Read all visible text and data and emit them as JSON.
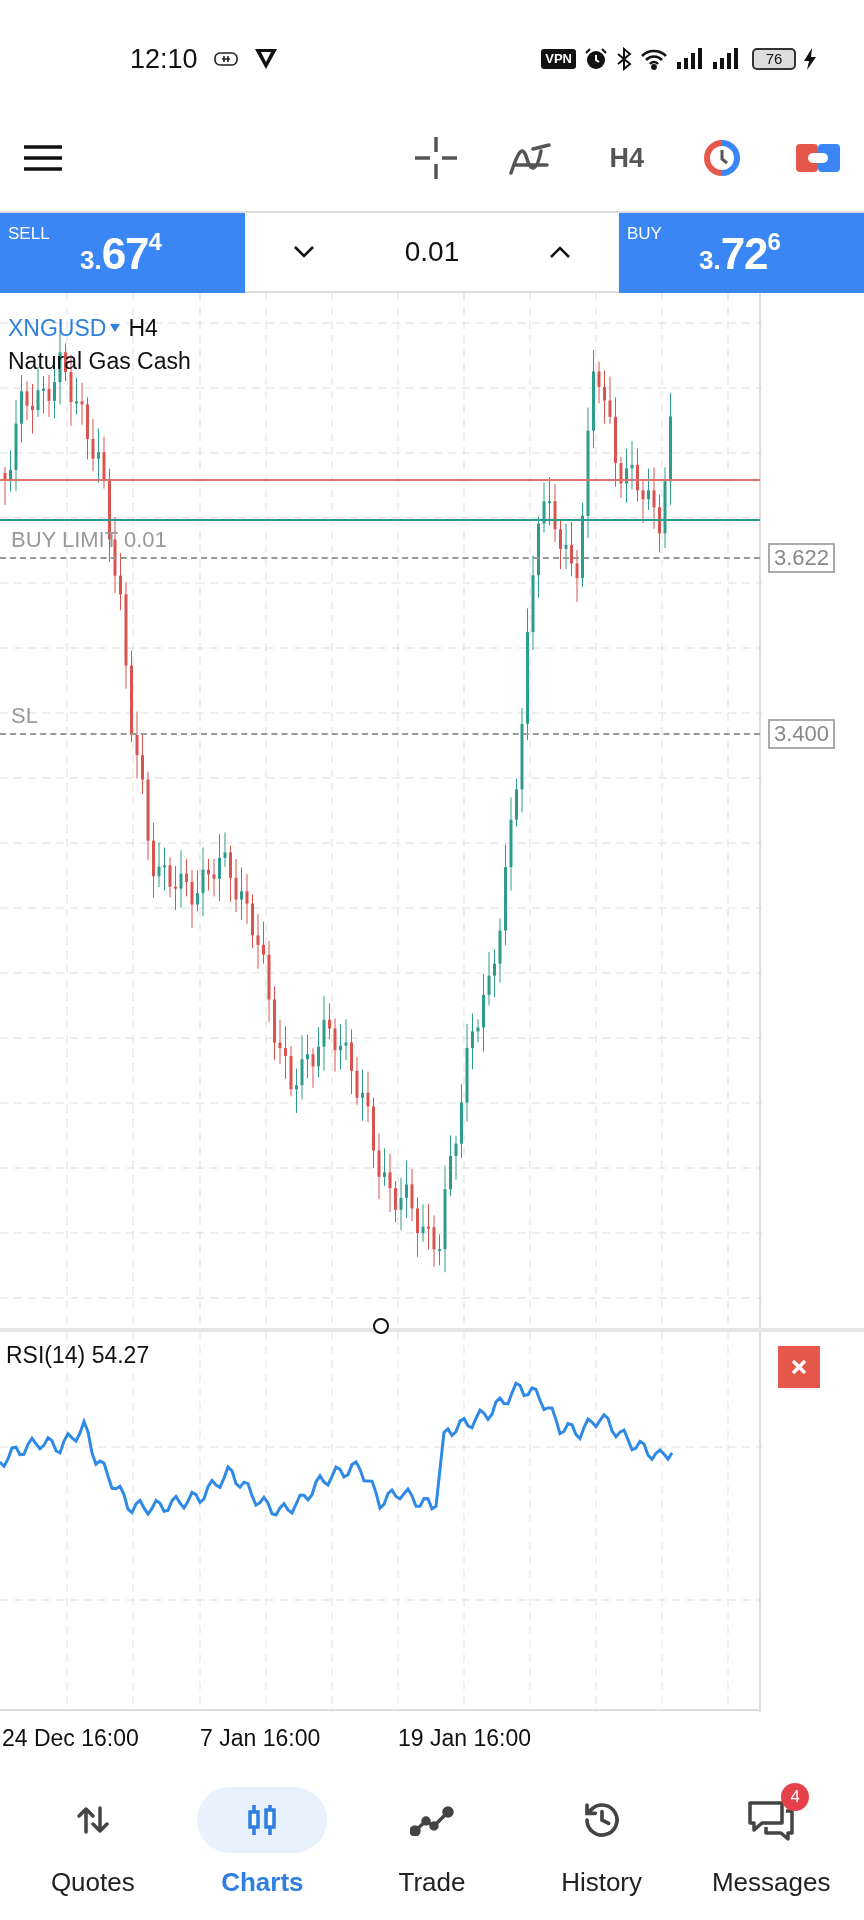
{
  "status_bar": {
    "time": "12:10",
    "vpn": "VPN",
    "battery": "76"
  },
  "toolbar": {
    "timeframe": "H4"
  },
  "trade_bar": {
    "sell": {
      "label": "SELL",
      "small": "3.",
      "big": "67",
      "pip": "4"
    },
    "volume": "0.01",
    "buy": {
      "label": "BUY",
      "small": "3.",
      "big": "72",
      "pip": "6"
    }
  },
  "chart": {
    "symbol": "XNGUSD",
    "timeframe": "H4",
    "description": "Natural Gas Cash",
    "orders": [
      {
        "label": "BUY LIMIT 0.01",
        "price": "3.622"
      },
      {
        "label": "SL",
        "price": "3.400"
      }
    ]
  },
  "indicator": {
    "title": "RSI(14) 54.27"
  },
  "time_axis": [
    "24 Dec 16:00",
    "7 Jan 16:00",
    "19 Jan 16:00"
  ],
  "nav": [
    {
      "label": "Quotes",
      "selected": false
    },
    {
      "label": "Charts",
      "selected": true
    },
    {
      "label": "Trade",
      "selected": false
    },
    {
      "label": "History",
      "selected": false
    },
    {
      "label": "Messages",
      "selected": false,
      "badge": "4"
    }
  ]
}
